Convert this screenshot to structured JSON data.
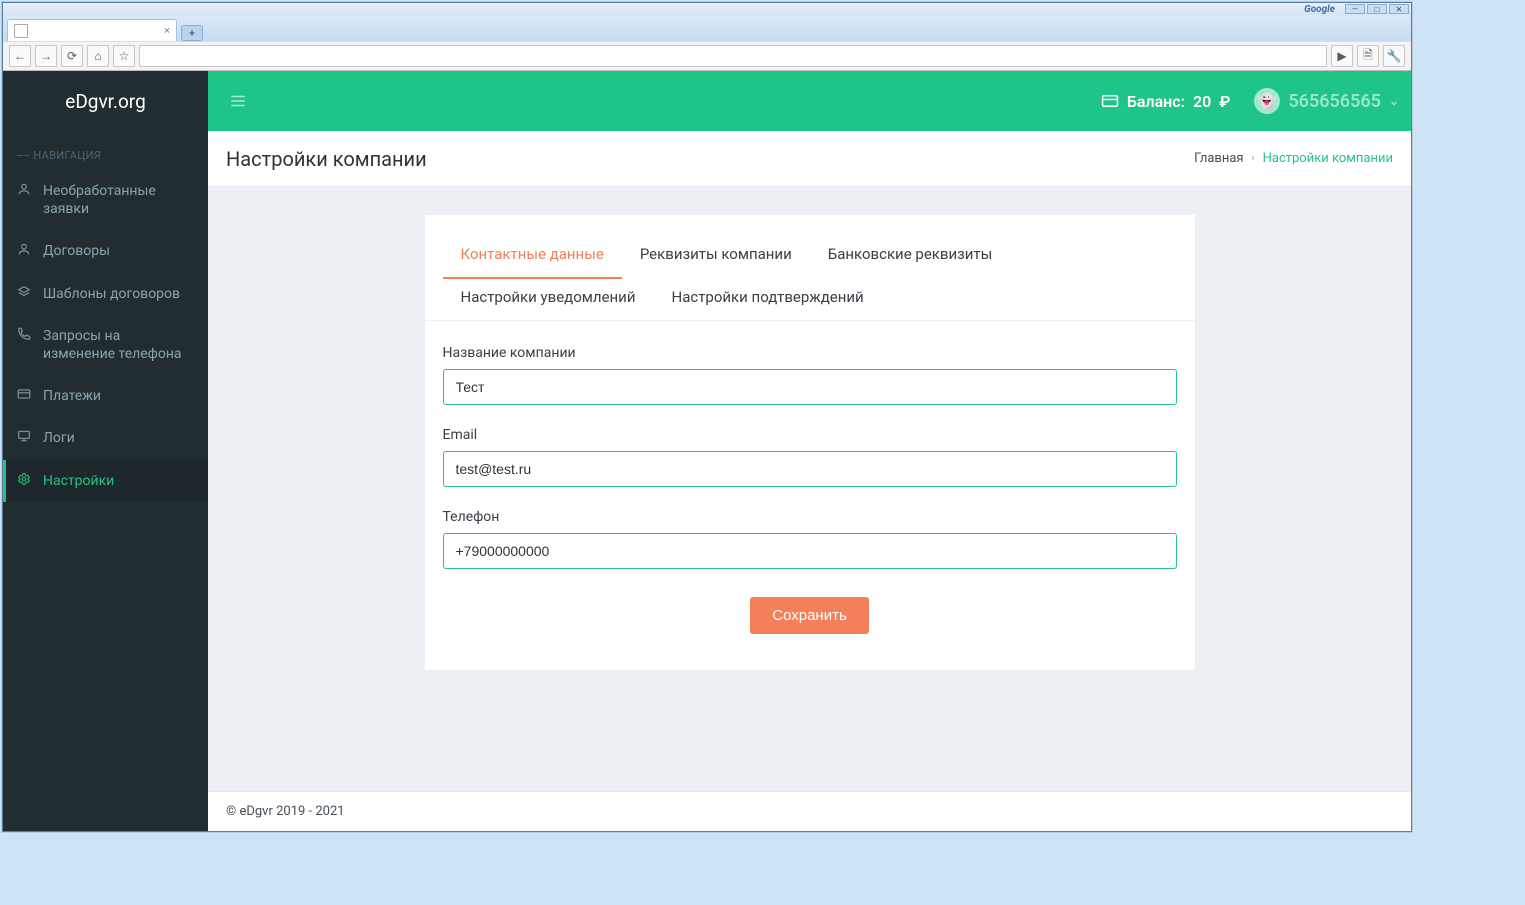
{
  "browser": {
    "search_brand": "Google",
    "win_min": "—",
    "win_max": "□",
    "win_close": "✕",
    "tab_close": "×",
    "newtab": "+",
    "back": "←",
    "forward": "→",
    "reload": "⟳",
    "home": "⌂",
    "star": "☆",
    "play": "▶",
    "page": "🗎",
    "wrench": "🔧"
  },
  "sidebar": {
    "brand": "eDgvr.org",
    "nav_header": "---- НАВИГАЦИЯ",
    "items": [
      {
        "icon": "user",
        "label": "Необработанные заявки"
      },
      {
        "icon": "user",
        "label": "Договоры"
      },
      {
        "icon": "stack",
        "label": "Шаблоны договоров"
      },
      {
        "icon": "phone",
        "label": "Запросы на изменение телефона"
      },
      {
        "icon": "card",
        "label": "Платежи"
      },
      {
        "icon": "monitor",
        "label": "Логи"
      },
      {
        "icon": "gear",
        "label": "Настройки"
      }
    ]
  },
  "topbar": {
    "balance_label": "Баланс:",
    "balance_value": "20",
    "currency": "₽",
    "username": "565656565",
    "caret": "⌄"
  },
  "page": {
    "title": "Настройки компании",
    "breadcrumb_home": "Главная",
    "breadcrumb_sep": "›",
    "breadcrumb_current": "Настройки компании"
  },
  "tabs": [
    "Контактные данные",
    "Реквизиты компании",
    "Банковские реквизиты",
    "Настройки уведомлений",
    "Настройки подтверждений"
  ],
  "form": {
    "company_label": "Название компании",
    "company_value": "Тест",
    "email_label": "Email",
    "email_value": "test@test.ru",
    "phone_label": "Телефон",
    "phone_value": "+79000000000",
    "save_label": "Сохранить"
  },
  "footer": {
    "text": "© eDgvr 2019 - 2021"
  }
}
